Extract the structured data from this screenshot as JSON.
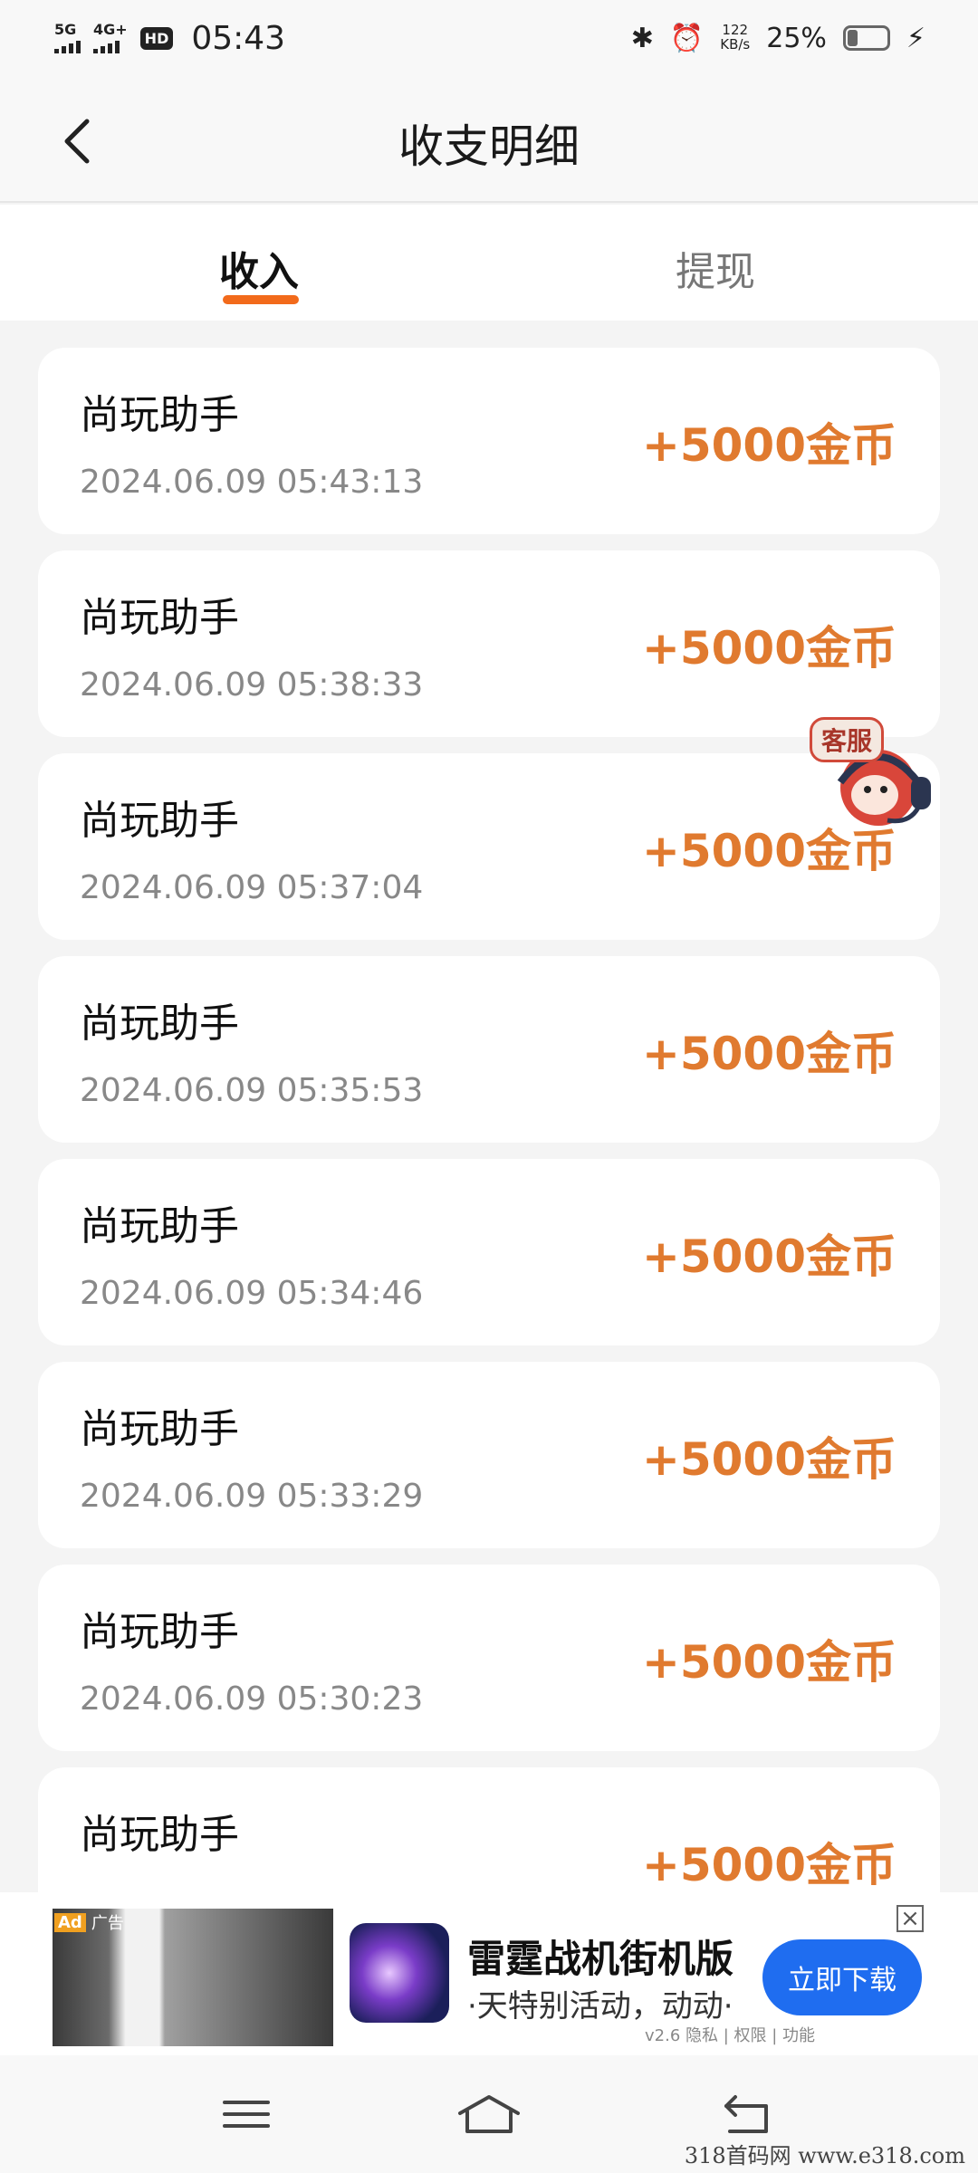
{
  "status_bar": {
    "net1": "5G",
    "net2": "4G+",
    "hd": "HD",
    "time": "05:43",
    "speed_value": "122",
    "speed_unit": "KB/s",
    "battery": "25%",
    "battery_level": 0.25
  },
  "header": {
    "title": "收支明细"
  },
  "tabs": [
    {
      "label": "收入"
    },
    {
      "label": "提现"
    }
  ],
  "transactions": [
    {
      "title": "尚玩助手",
      "time": "2024.06.09 05:43:13",
      "amount": "+5000金币"
    },
    {
      "title": "尚玩助手",
      "time": "2024.06.09 05:38:33",
      "amount": "+5000金币"
    },
    {
      "title": "尚玩助手",
      "time": "2024.06.09 05:37:04",
      "amount": "+5000金币"
    },
    {
      "title": "尚玩助手",
      "time": "2024.06.09 05:35:53",
      "amount": "+5000金币"
    },
    {
      "title": "尚玩助手",
      "time": "2024.06.09 05:34:46",
      "amount": "+5000金币"
    },
    {
      "title": "尚玩助手",
      "time": "2024.06.09 05:33:29",
      "amount": "+5000金币"
    },
    {
      "title": "尚玩助手",
      "time": "2024.06.09 05:30:23",
      "amount": "+5000金币"
    },
    {
      "title": "尚玩助手",
      "time": "",
      "amount": "+5000金币"
    }
  ],
  "customer_service": {
    "label": "客服"
  },
  "ad": {
    "tag": "Ad",
    "tag_text": "广告",
    "title": "雷霆战机街机版",
    "subtitle": "·天特别活动，动动·",
    "button": "立即下载",
    "meta": "v2.6  隐私 | 权限 | 功能"
  },
  "watermark": "318首码网  www.e318.com",
  "colors": {
    "accent": "#f26a1b",
    "amount": "#e07a2f",
    "ad_button": "#1f6df0"
  }
}
